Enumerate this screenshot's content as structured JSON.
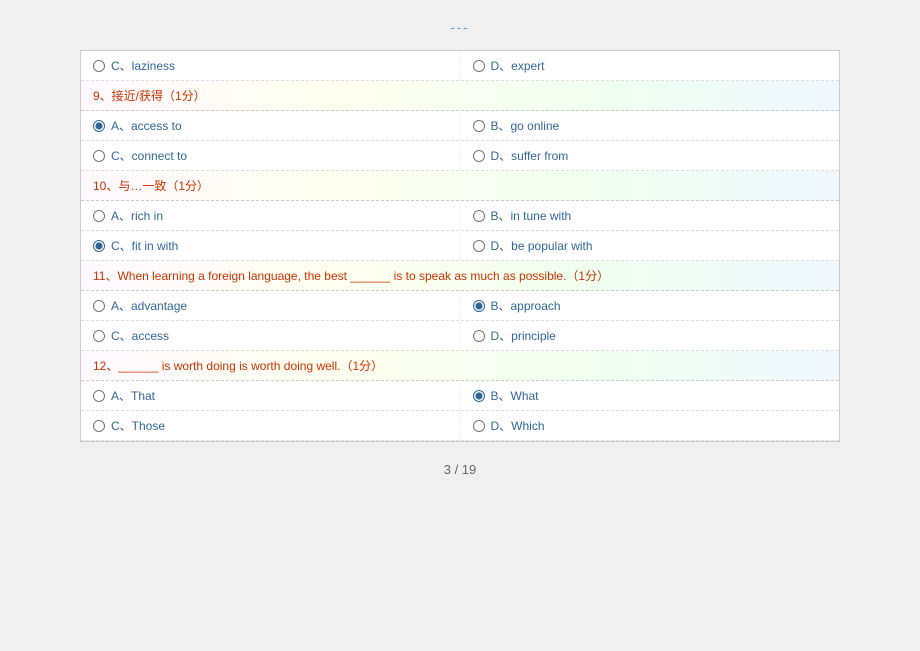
{
  "nav": "---",
  "questions": [
    {
      "id": "q_prev",
      "section_label": null,
      "options": [
        {
          "id": "opt_c_lazy",
          "label": "C、laziness",
          "selected": false,
          "side": "left"
        },
        {
          "id": "opt_d_expert",
          "label": "D、expert",
          "selected": false,
          "side": "right"
        }
      ]
    },
    {
      "id": "q9",
      "section_label": "9、接近/获得（1分）",
      "options": [
        {
          "id": "opt_a_access_to",
          "label": "A、access   to",
          "selected": true,
          "side": "left"
        },
        {
          "id": "opt_b_go_online",
          "label": "B、go   online",
          "selected": false,
          "side": "right"
        },
        {
          "id": "opt_c_connect_to",
          "label": "C、connect   to",
          "selected": false,
          "side": "left"
        },
        {
          "id": "opt_d_suffer_from",
          "label": "D、suffer   from",
          "selected": false,
          "side": "right"
        }
      ]
    },
    {
      "id": "q10",
      "section_label": "10、与…一致（1分）",
      "options": [
        {
          "id": "opt_a_rich_in",
          "label": "A、rich   in",
          "selected": false,
          "side": "left"
        },
        {
          "id": "opt_b_in_tune_with",
          "label": "B、in   tune   with",
          "selected": false,
          "side": "right"
        },
        {
          "id": "opt_c_fit_in_with",
          "label": "C、fit   in   with",
          "selected": true,
          "side": "left"
        },
        {
          "id": "opt_d_be_popular_with",
          "label": "D、be   popular   with",
          "selected": false,
          "side": "right"
        }
      ]
    },
    {
      "id": "q11",
      "section_label": "11、When learning a foreign language, the best ______ is to speak as much as possible.（1分）",
      "options": [
        {
          "id": "opt_a_advantage",
          "label": "A、advantage",
          "selected": false,
          "side": "left"
        },
        {
          "id": "opt_b_approach",
          "label": "B、approach",
          "selected": true,
          "side": "right"
        },
        {
          "id": "opt_c_access",
          "label": "C、access",
          "selected": false,
          "side": "left"
        },
        {
          "id": "opt_d_principle",
          "label": "D、principle",
          "selected": false,
          "side": "right"
        }
      ]
    },
    {
      "id": "q12",
      "section_label": "12、______ is worth doing is worth doing well.（1分）",
      "options": [
        {
          "id": "opt_a_that",
          "label": "A、That",
          "selected": false,
          "side": "left"
        },
        {
          "id": "opt_b_what",
          "label": "B、What",
          "selected": true,
          "side": "right"
        },
        {
          "id": "opt_c_those",
          "label": "C、Those",
          "selected": false,
          "side": "left"
        },
        {
          "id": "opt_d_which",
          "label": "D、Which",
          "selected": false,
          "side": "right"
        }
      ]
    }
  ],
  "pagination": {
    "current": "3",
    "total": "19",
    "label": "3 / 19"
  }
}
